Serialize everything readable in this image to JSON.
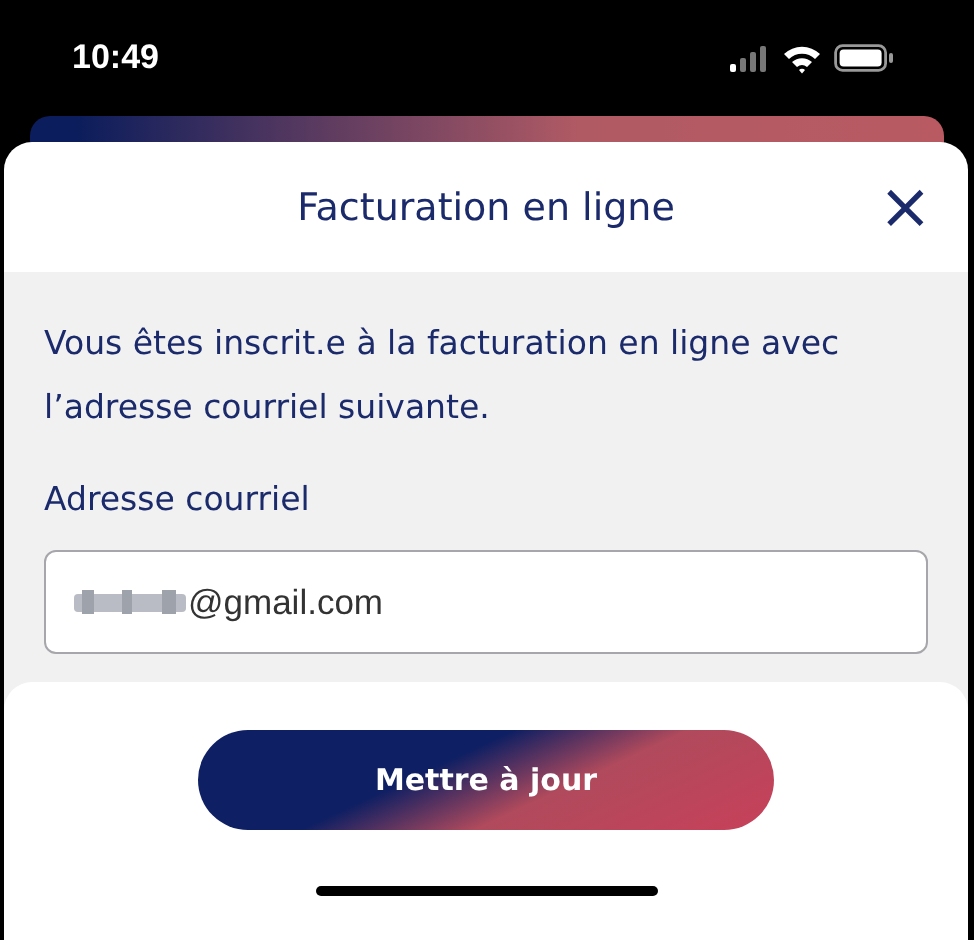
{
  "status_bar": {
    "time": "10:49"
  },
  "sheet": {
    "title": "Facturation en ligne",
    "close": "×"
  },
  "message": "Vous êtes inscrit.e à la facturation en ligne avec l’adresse courriel suivante.",
  "email_field": {
    "label": "Adresse courriel",
    "value": "@gmail.com"
  },
  "button": "Mettre à jour"
}
